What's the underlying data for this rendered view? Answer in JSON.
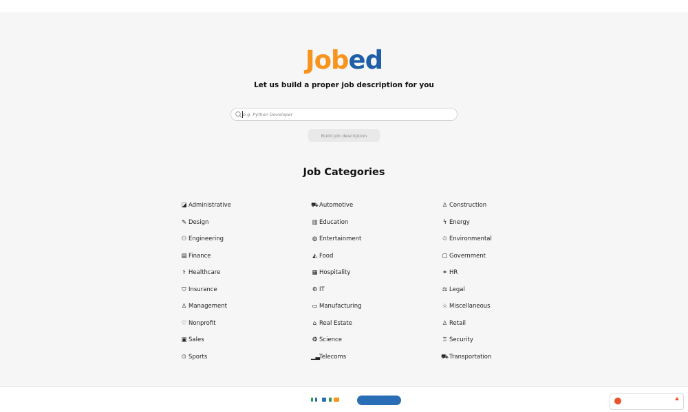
{
  "brand": {
    "logo_part1": "Job",
    "logo_part2": "ed"
  },
  "hero": {
    "subtitle": "Let us build a proper job description for you",
    "search_placeholder": "e.g. Python Developer",
    "build_button_label": "Build job description"
  },
  "categories": {
    "title": "Job Categories",
    "columns": [
      [
        {
          "label": "Administrative",
          "icon": "folder-icon"
        },
        {
          "label": "Design",
          "icon": "pencil-icon"
        },
        {
          "label": "Engineering",
          "icon": "engineer-icon"
        },
        {
          "label": "Finance",
          "icon": "ledger-icon"
        },
        {
          "label": "Healthcare",
          "icon": "doctor-icon"
        },
        {
          "label": "Insurance",
          "icon": "shield-icon"
        },
        {
          "label": "Management",
          "icon": "manager-icon"
        },
        {
          "label": "Nonprofit",
          "icon": "heart-icon"
        },
        {
          "label": "Sales",
          "icon": "briefcase-icon"
        },
        {
          "label": "Sports",
          "icon": "dumbbell-icon"
        }
      ],
      [
        {
          "label": "Automotive",
          "icon": "car-icon"
        },
        {
          "label": "Education",
          "icon": "book-icon"
        },
        {
          "label": "Entertainment",
          "icon": "palette-icon"
        },
        {
          "label": "Food",
          "icon": "food-icon"
        },
        {
          "label": "Hospitality",
          "icon": "hotel-icon"
        },
        {
          "label": "IT",
          "icon": "gear-icon"
        },
        {
          "label": "Manufacturing",
          "icon": "factory-icon"
        },
        {
          "label": "Real Estate",
          "icon": "house-icon"
        },
        {
          "label": "Science",
          "icon": "atom-icon"
        },
        {
          "label": "Telecoms",
          "icon": "signal-icon"
        }
      ],
      [
        {
          "label": "Construction",
          "icon": "hardhat-icon"
        },
        {
          "label": "Energy",
          "icon": "bolt-icon"
        },
        {
          "label": "Environmental",
          "icon": "recycle-icon"
        },
        {
          "label": "Government",
          "icon": "clipboard-icon"
        },
        {
          "label": "HR",
          "icon": "handshake-icon"
        },
        {
          "label": "Legal",
          "icon": "scales-icon"
        },
        {
          "label": "Miscellaneous",
          "icon": "star-icon"
        },
        {
          "label": "Retail",
          "icon": "cashier-icon"
        },
        {
          "label": "Security",
          "icon": "guard-icon"
        },
        {
          "label": "Transportation",
          "icon": "truck-icon"
        }
      ]
    ]
  },
  "colors": {
    "brand_orange": "#f7941d",
    "brand_blue": "#1f5fa8",
    "background": "#f6f6f6",
    "button_bg": "#e9e9e9"
  }
}
